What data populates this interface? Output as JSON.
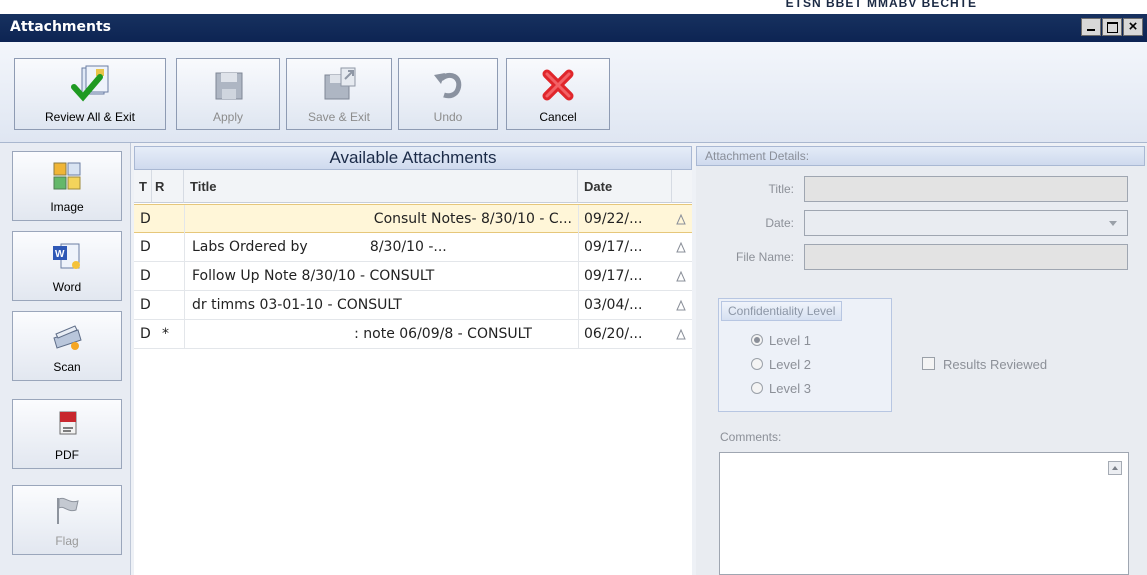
{
  "top_strip_text": "ETSN  BBET MMABV BECHTE",
  "window": {
    "title": "Attachments",
    "close_glyph": "×"
  },
  "toolbar": {
    "review_all_exit": "Review All & Exit",
    "apply": "Apply",
    "save_exit": "Save & Exit",
    "undo": "Undo",
    "cancel": "Cancel"
  },
  "sidebar": {
    "image": "Image",
    "word": "Word",
    "scan": "Scan",
    "pdf": "PDF",
    "flag": "Flag"
  },
  "attachments": {
    "header": "Available Attachments",
    "columns": {
      "t": "T",
      "r": "R",
      "title": "Title",
      "date": "Date"
    },
    "rows": [
      {
        "t": "D",
        "r": "",
        "title": "Consult Notes- 8/30/10 - C...",
        "date": "09/22/..."
      },
      {
        "t": "D",
        "r": "",
        "title": "Labs Ordered by              8/30/10 -...",
        "date": "09/17/..."
      },
      {
        "t": "D",
        "r": "",
        "title": "Follow Up Note 8/30/10 - CONSULT",
        "date": "09/17/..."
      },
      {
        "t": "D",
        "r": "",
        "title": "dr timms 03-01-10 - CONSULT",
        "date": "03/04/..."
      },
      {
        "t": "D",
        "r": "*",
        "title": ": note 06/09/8 - CONSULT",
        "date": "06/20/..."
      }
    ]
  },
  "details": {
    "header": "Attachment Details:",
    "title_label": "Title:",
    "date_label": "Date:",
    "filename_label": "File Name:",
    "confidentiality": {
      "title": "Confidentiality Level",
      "level1": "Level 1",
      "level2": "Level 2",
      "level3": "Level 3",
      "selected": "Level 1"
    },
    "results_reviewed": "Results Reviewed",
    "comments_label": "Comments:"
  }
}
